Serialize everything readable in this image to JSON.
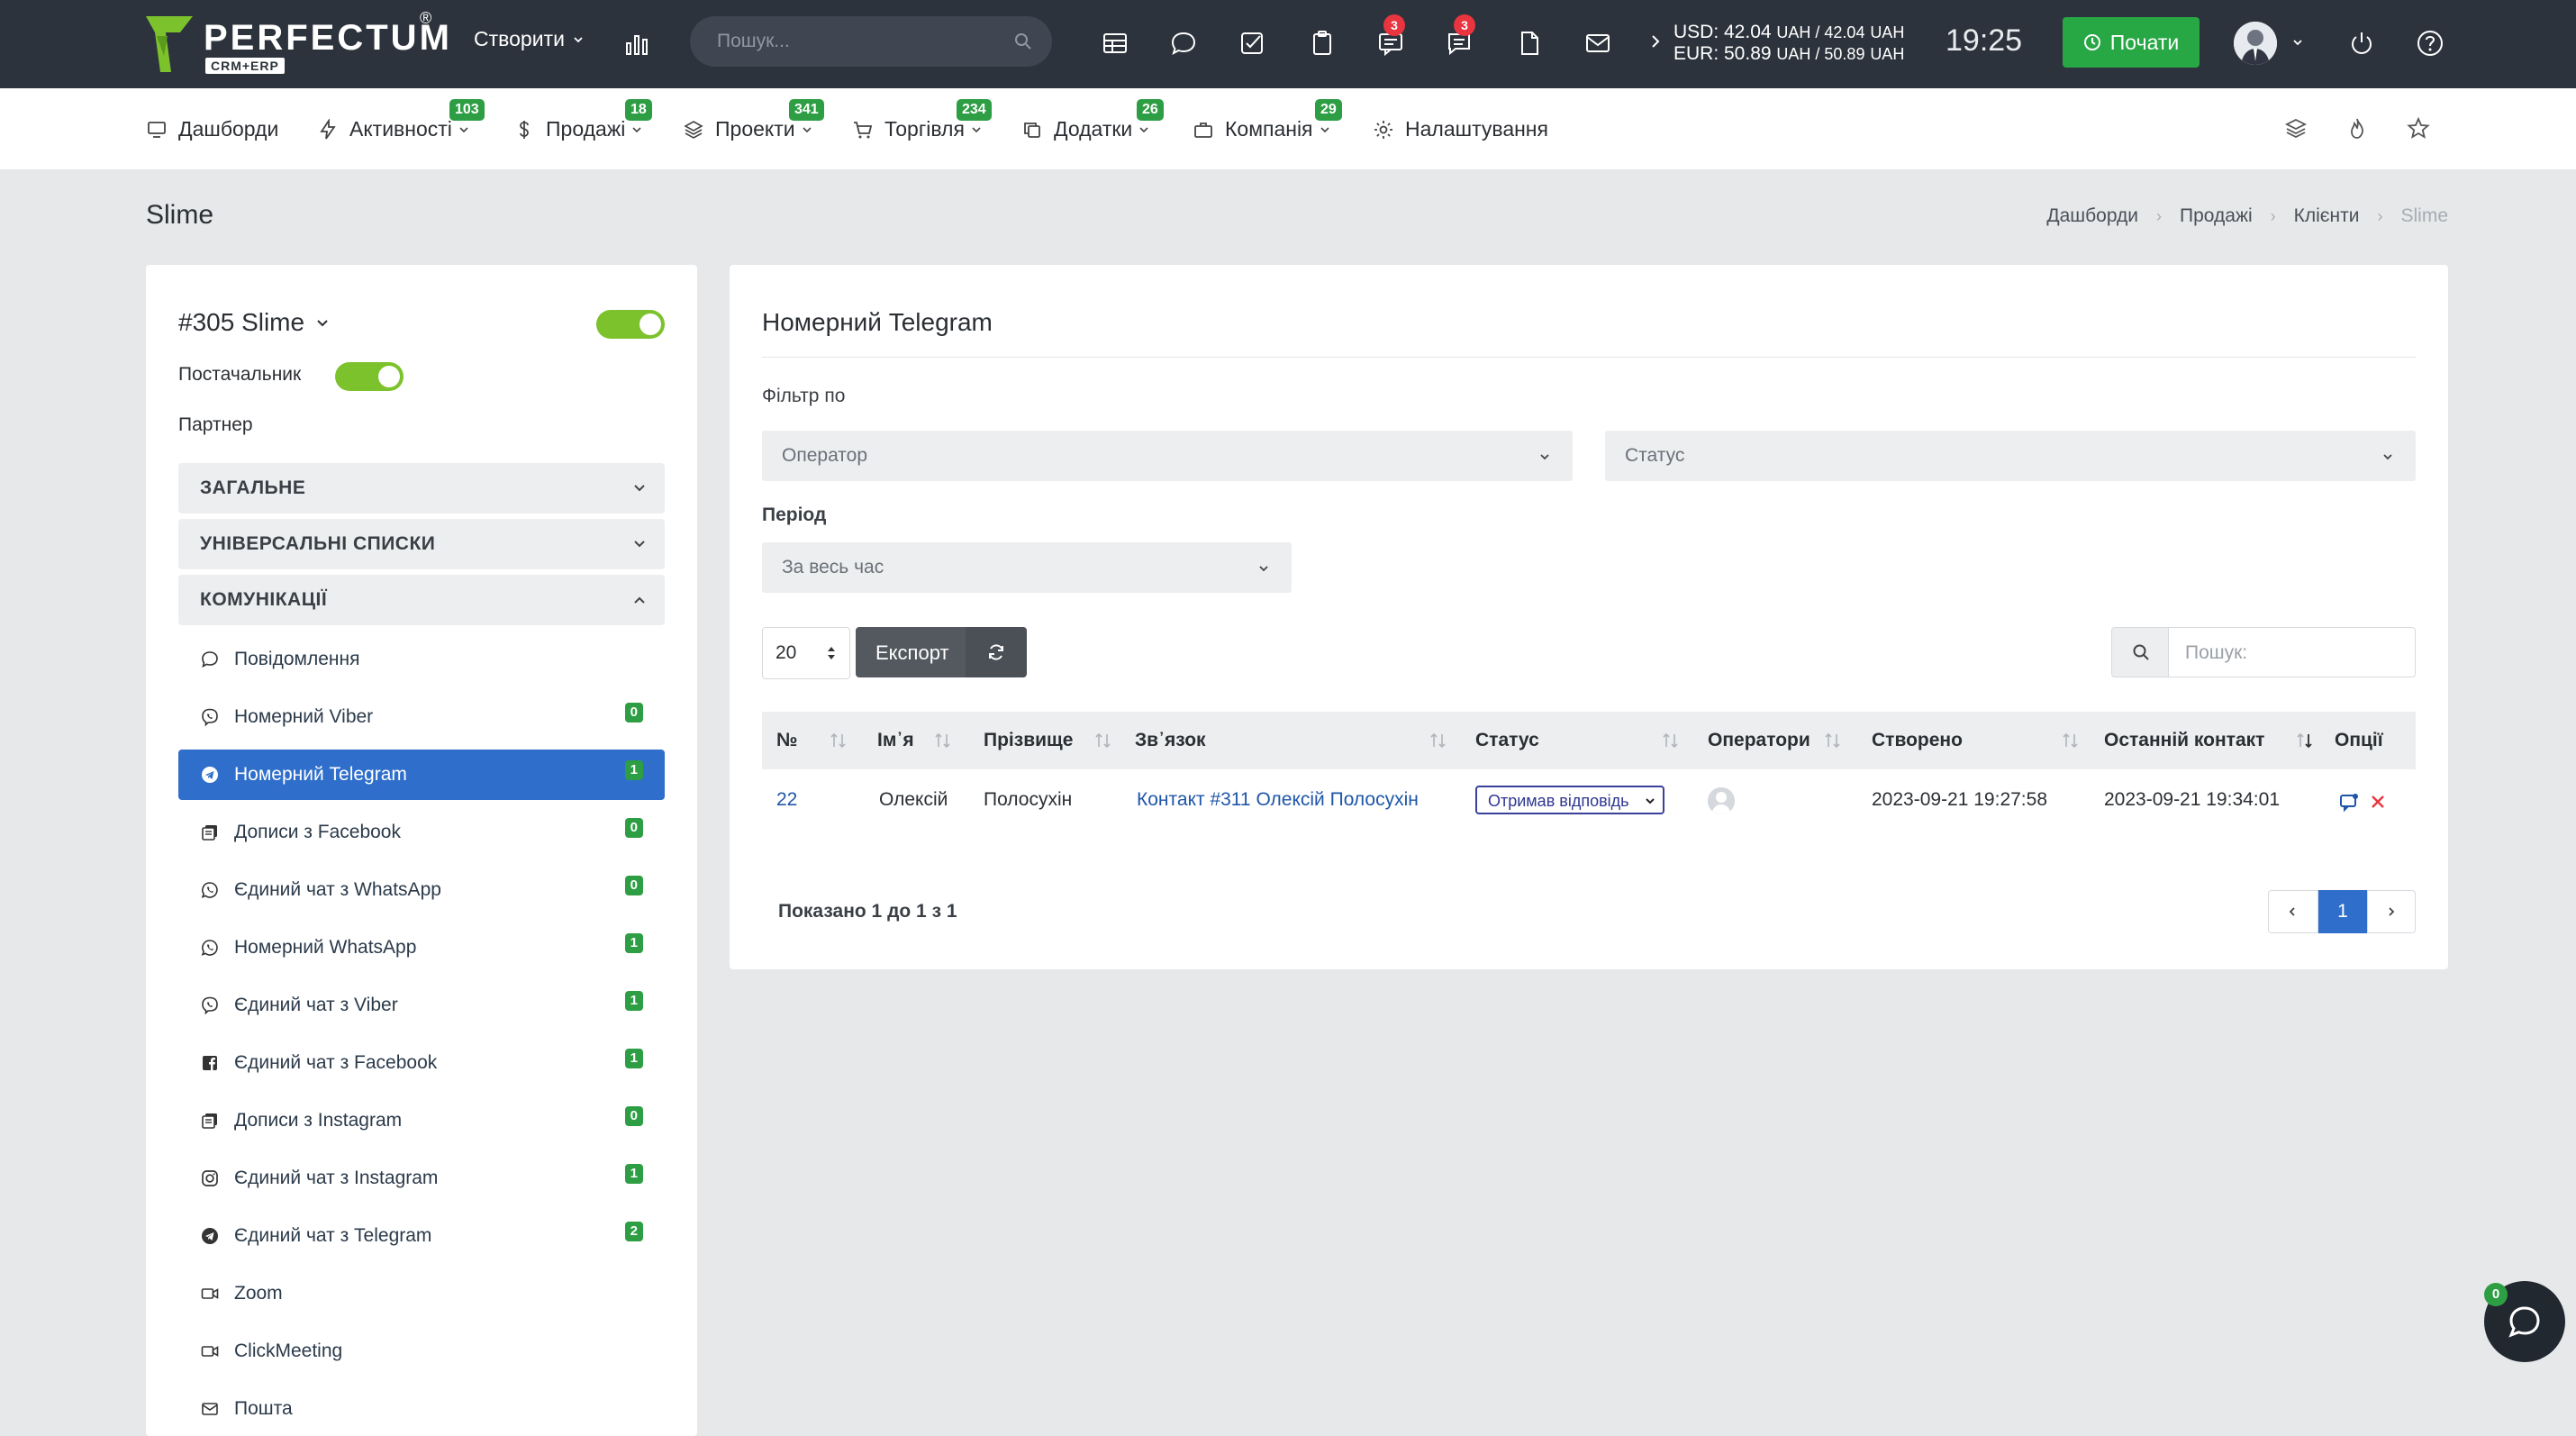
{
  "brand": {
    "name": "PERFECTUM",
    "reg": "®",
    "sub": "CRM+ERP"
  },
  "topbar": {
    "create_label": "Створити",
    "search_placeholder": "Пошук...",
    "badges": {
      "chat": "3",
      "messages": "3"
    },
    "currency": {
      "usd": "USD: 42.04",
      "usd_unit": "UAH / 42.04",
      "usd_unit2": "UAH",
      "eur": "EUR: 50.89",
      "eur_unit": "UAH / 50.89",
      "eur_unit2": "UAH"
    },
    "time": "19:25",
    "start_label": "Почати"
  },
  "nav": {
    "items": [
      {
        "label": "Дашборди",
        "icon": "monitor-icon",
        "badge": ""
      },
      {
        "label": "Активності",
        "icon": "bolt-icon",
        "badge": "103"
      },
      {
        "label": "Продажі",
        "icon": "dollar-icon",
        "badge": "18"
      },
      {
        "label": "Проекти",
        "icon": "layers-icon",
        "badge": "341"
      },
      {
        "label": "Торгівля",
        "icon": "cart-icon",
        "badge": "234"
      },
      {
        "label": "Додатки",
        "icon": "copy-icon",
        "badge": "26"
      },
      {
        "label": "Компанія",
        "icon": "briefcase-icon",
        "badge": "29"
      },
      {
        "label": "Налаштування",
        "icon": "gear-icon",
        "badge": ""
      }
    ]
  },
  "page": {
    "title": "Slime",
    "breadcrumb": [
      "Дашборди",
      "Продажі",
      "Клієнти",
      "Slime"
    ]
  },
  "client": {
    "name": "#305 Slime",
    "supplier_label": "Постачальник",
    "partner_label": "Партнер",
    "sections": [
      "ЗАГАЛЬНЕ",
      "УНІВЕРСАЛЬНІ СПИСКИ",
      "КОМУНІКАЦІЇ"
    ],
    "menu": [
      {
        "label": "Повідомлення",
        "count": ""
      },
      {
        "label": "Номерний Viber",
        "count": "0"
      },
      {
        "label": "Номерний Telegram",
        "count": "1"
      },
      {
        "label": "Дописи з Facebook",
        "count": "0"
      },
      {
        "label": "Єдиний чат з WhatsApp",
        "count": "0"
      },
      {
        "label": "Номерний WhatsApp",
        "count": "1"
      },
      {
        "label": "Єдиний чат з Viber",
        "count": "1"
      },
      {
        "label": "Єдиний чат з Facebook",
        "count": "1"
      },
      {
        "label": "Дописи з Instagram",
        "count": "0"
      },
      {
        "label": "Єдиний чат з Instagram",
        "count": "1"
      },
      {
        "label": "Єдиний чат з Telegram",
        "count": "2"
      },
      {
        "label": "Zoom",
        "count": ""
      },
      {
        "label": "ClickMeeting",
        "count": ""
      },
      {
        "label": "Пошта",
        "count": ""
      }
    ]
  },
  "main": {
    "title": "Номерний Telegram",
    "filter_label": "Фільтр по",
    "operator_placeholder": "Оператор",
    "status_placeholder": "Статус",
    "period_label": "Період",
    "period_value": "За весь час",
    "page_size": "20",
    "export_label": "Експорт",
    "search_placeholder": "Пошук:",
    "columns": [
      "№",
      "Ім᾽я",
      "Прізвище",
      "Зв᾽язок",
      "Статус",
      "Оператори",
      "Створено",
      "Останній контакт",
      "Опції"
    ],
    "rows": [
      {
        "num": "22",
        "first": "Олексій",
        "last": "Полосухін",
        "link": "Контакт #311 Олексій Полосухін",
        "status": "Отримав відповідь",
        "created": "2023-09-21 19:27:58",
        "last_contact": "2023-09-21 19:34:01"
      }
    ],
    "shown_text": "Показано 1 до 1 з 1",
    "current_page": "1"
  },
  "chat": {
    "badge": "0"
  },
  "colors": {
    "topbar": "#2d333c",
    "accent": "#2f6fcb",
    "green": "#28a745",
    "toggle": "#7cc22c",
    "badge_red": "#e8353f"
  }
}
